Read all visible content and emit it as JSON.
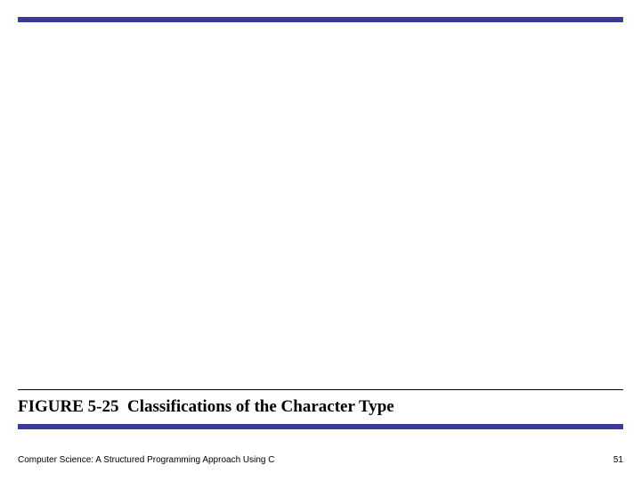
{
  "figure": {
    "label": "FIGURE 5-25",
    "title": "Classifications of the Character Type"
  },
  "footer": {
    "book_title": "Computer Science: A Structured Programming Approach Using C",
    "page_number": "51"
  }
}
